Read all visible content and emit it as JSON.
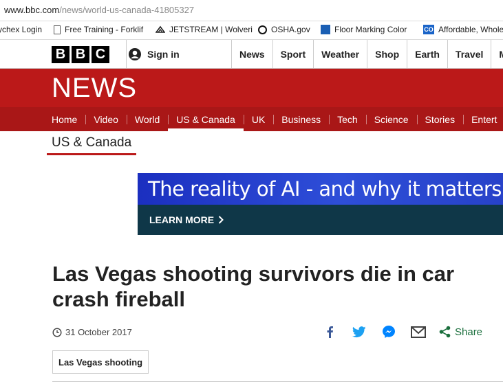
{
  "browser": {
    "url_domain": "www.bbc.com",
    "url_path": "/news/world-us-canada-41805327"
  },
  "bookmarks": [
    {
      "label": "ychex Login",
      "icon": "none"
    },
    {
      "label": "Free Training - Forklif",
      "icon": "document-icon"
    },
    {
      "label": "JETSTREAM | Wolveri",
      "icon": "jetstream-icon"
    },
    {
      "label": "OSHA.gov",
      "icon": "osha-icon"
    },
    {
      "label": "Floor Marking Color",
      "icon": "floor-marking-icon"
    },
    {
      "label": "Affordable, Whole",
      "icon": "co-icon"
    }
  ],
  "bbc": {
    "logo_letters": [
      "B",
      "B",
      "C"
    ],
    "signin_label": "Sign in",
    "top_nav": [
      "News",
      "Sport",
      "Weather",
      "Shop",
      "Earth",
      "Travel",
      "M"
    ]
  },
  "news": {
    "title": "NEWS",
    "sub_nav": [
      "Home",
      "Video",
      "World",
      "US & Canada",
      "UK",
      "Business",
      "Tech",
      "Science",
      "Stories",
      "Entert"
    ],
    "active_sub_nav": "US & Canada"
  },
  "section": {
    "label": "US & Canada"
  },
  "ad": {
    "tagline": "The reality of AI - and why it matters for",
    "cta": "LEARN MORE"
  },
  "article": {
    "headline": "Las Vegas shooting survivors die in car crash fireball",
    "date": "31 October 2017",
    "share_label": "Share",
    "tag": "Las Vegas shooting"
  },
  "colors": {
    "bbc_red": "#bb1919",
    "subnav_red": "#a91717",
    "ad_blue": "#2e4ed8",
    "ad_dark": "#0f3748",
    "facebook": "#3b5998",
    "twitter": "#1da1f2",
    "messenger": "#0084ff",
    "share_green": "#1a6e3c"
  }
}
